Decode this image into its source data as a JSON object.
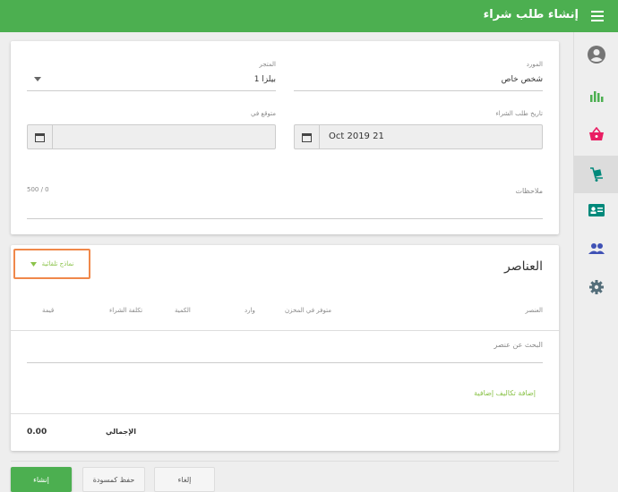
{
  "header": {
    "title": "إنشاء طلب شراء"
  },
  "form": {
    "supplier": {
      "label": "المورد",
      "value": "شخص خاص"
    },
    "store": {
      "label": "المتجر",
      "value": "بيلزا 1"
    },
    "order_date": {
      "label": "تاريخ طلب الشراء",
      "value": "Oct 2019 21"
    },
    "expected": {
      "label": "متوقع في",
      "value": ""
    },
    "notes": {
      "label": "ملاحظات",
      "counter": "500 / 0"
    }
  },
  "items": {
    "title": "العناصر",
    "template_dropdown": "نماذج تلقائية",
    "columns": [
      "العنصر",
      "متوفر في المخزن",
      "وارد",
      "الكمية",
      "تكلفة الشراء",
      "قيمة"
    ],
    "search_placeholder": "البحث عن عنصر",
    "add_costs": "إضافة تكاليف إضافية",
    "total_label": "الإجمالي",
    "total_value": "0.00"
  },
  "buttons": {
    "create": "إنشاء",
    "save_draft": "حفظ كمسودة",
    "cancel": "إلغاء"
  },
  "colors": {
    "primary": "#4caf50",
    "highlight": "#f0884a",
    "link": "#8bc34a"
  },
  "sidebar_icons": [
    "account-icon",
    "reports-icon",
    "sales-icon",
    "inventory-icon",
    "employees-icon",
    "customers-icon",
    "settings-icon"
  ]
}
